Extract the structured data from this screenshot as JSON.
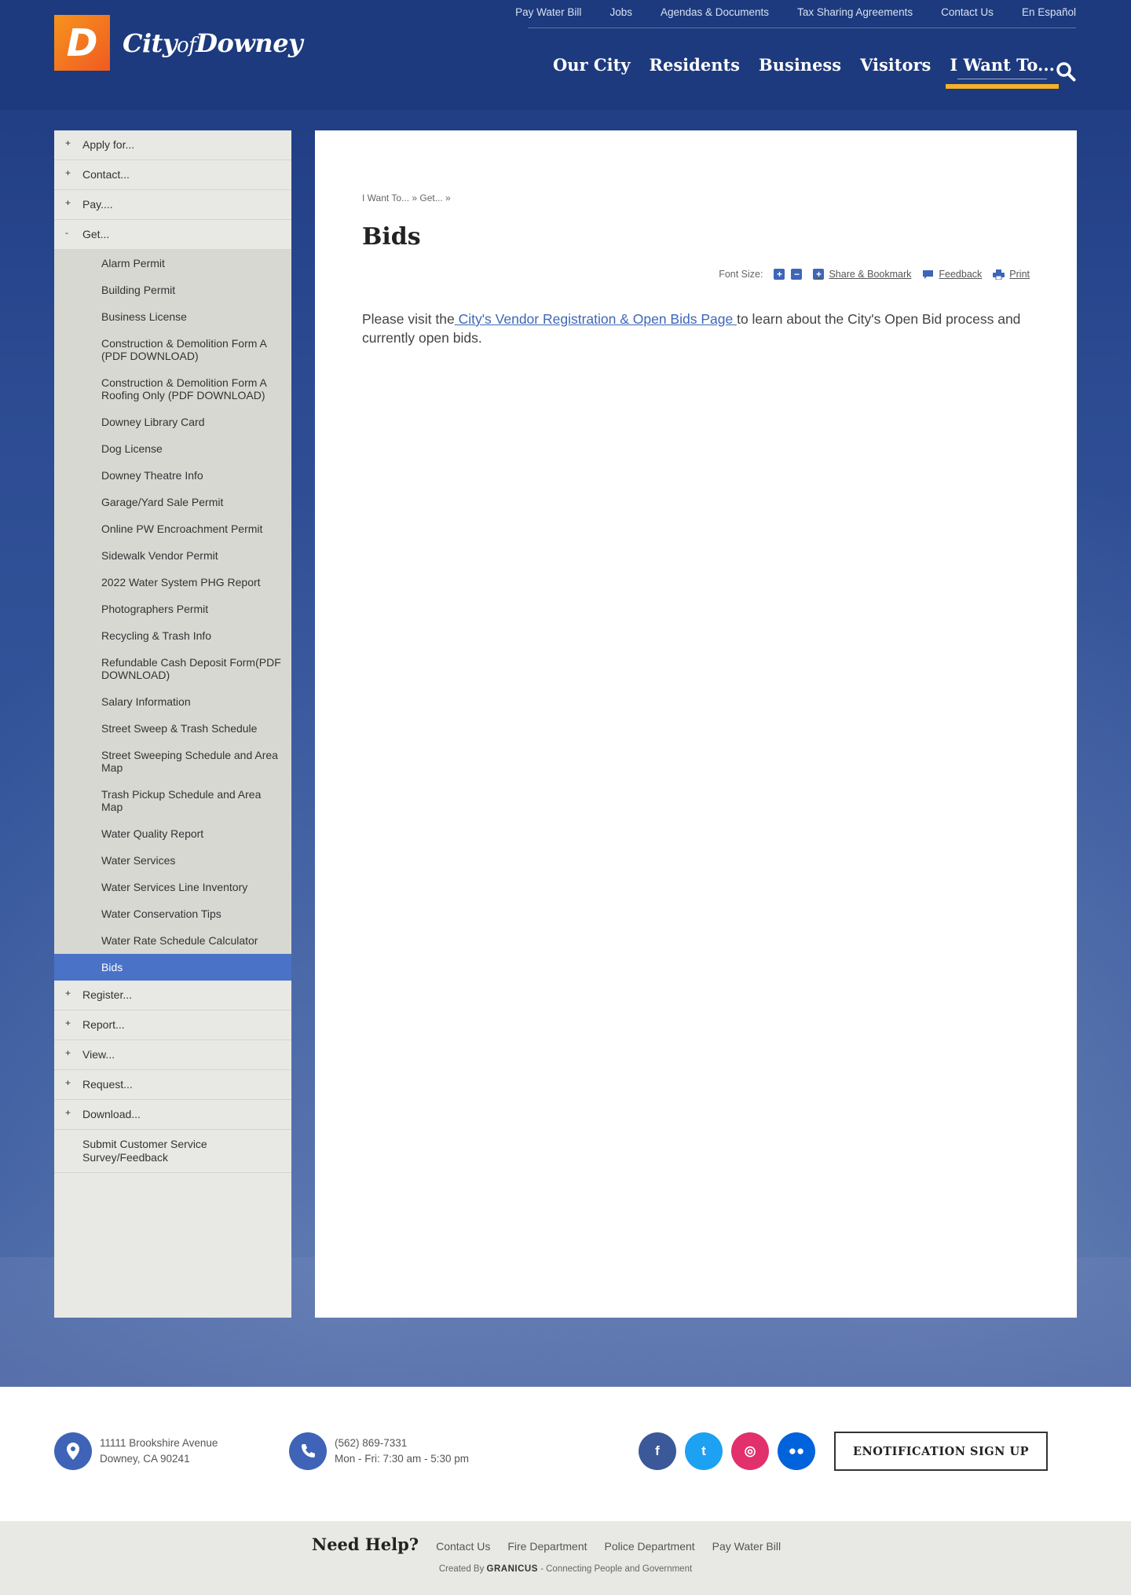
{
  "header": {
    "logo_letter": "D",
    "logo_city": "City",
    "logo_of": "of",
    "logo_downey": "Downey",
    "utility_links": [
      "Pay Water Bill",
      "Jobs",
      "Agendas & Documents",
      "Tax Sharing Agreements",
      "Contact Us",
      "En Español"
    ],
    "main_nav": [
      "Our City",
      "Residents",
      "Business",
      "Visitors",
      "I Want To..."
    ],
    "active_nav": "I Want To..."
  },
  "sidebar": {
    "top_items": [
      {
        "symbol": "+",
        "label": "Apply for..."
      },
      {
        "symbol": "+",
        "label": "Contact..."
      },
      {
        "symbol": "+",
        "label": "Pay...."
      },
      {
        "symbol": "-",
        "label": "Get..."
      }
    ],
    "sub_items": [
      "Alarm Permit",
      "Building Permit",
      "Business License",
      "Construction & Demolition Form A (PDF DOWNLOAD)",
      "Construction & Demolition Form A Roofing Only (PDF DOWNLOAD)",
      "Downey Library Card",
      "Dog License",
      "Downey Theatre Info",
      "Garage/Yard Sale Permit",
      "Online PW Encroachment Permit",
      "Sidewalk Vendor Permit",
      "2022 Water System PHG Report",
      "Photographers Permit",
      "Recycling & Trash Info",
      "Refundable Cash Deposit Form(PDF DOWNLOAD)",
      "Salary Information",
      "Street Sweep & Trash Schedule",
      "Street Sweeping Schedule and Area Map",
      "Trash Pickup Schedule and Area Map",
      "Water Quality Report",
      "Water Services",
      "Water Services Line Inventory",
      "Water Conservation Tips",
      "Water Rate Schedule Calculator",
      "Bids"
    ],
    "active_sub": "Bids",
    "bottom_items": [
      {
        "symbol": "+",
        "label": "Register..."
      },
      {
        "symbol": "+",
        "label": "Report..."
      },
      {
        "symbol": "+",
        "label": "View..."
      },
      {
        "symbol": "+",
        "label": "Request..."
      },
      {
        "symbol": "+",
        "label": "Download..."
      },
      {
        "symbol": "",
        "label": "Submit Customer Service Survey/Feedback"
      }
    ]
  },
  "content": {
    "breadcrumb": "I Want To... » Get... »",
    "title": "Bids",
    "font_size_label": "Font Size:",
    "share_label": "Share & Bookmark",
    "feedback_label": "Feedback",
    "print_label": "Print",
    "body_prefix": "Please visit the",
    "body_link": " City's Vendor Registration & Open Bids Page ",
    "body_suffix": "to learn about the City's  Open Bid process and currently open bids."
  },
  "footer": {
    "address_line1": "11111 Brookshire Avenue",
    "address_line2": "Downey, CA 90241",
    "phone": "(562) 869-7331",
    "hours": "Mon - Fri: 7:30 am - 5:30 pm",
    "social": [
      {
        "name": "facebook",
        "glyph": "f",
        "color": "#3b5998"
      },
      {
        "name": "twitter",
        "glyph": "t",
        "color": "#1da1f2"
      },
      {
        "name": "instagram",
        "glyph": "◎",
        "color": "#e1306c"
      },
      {
        "name": "flickr",
        "glyph": "●●",
        "color": "#0063dc"
      }
    ],
    "enotify_label": "ENOTIFICATION SIGN UP",
    "need_help": "Need Help?",
    "help_links": [
      "Contact Us",
      "Fire Department",
      "Police Department",
      "Pay Water Bill"
    ],
    "credit_prefix": "Created By",
    "credit_brand": "GRANICUS",
    "credit_suffix": "- Connecting People and Government"
  },
  "colors": {
    "header_bg": "#1c3a7d",
    "accent_underline": "#f5b127",
    "active_item": "#4a72c7",
    "link": "#3d66b7"
  }
}
